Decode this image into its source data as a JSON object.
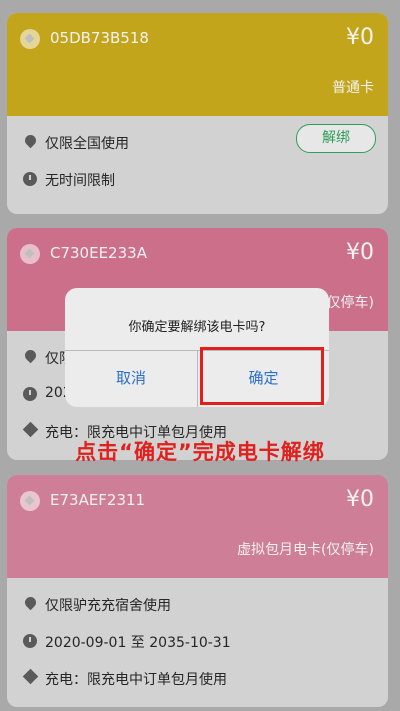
{
  "cards": [
    {
      "id": "05DB73B518",
      "amount": "¥0",
      "type": "普通卡",
      "scope": "仅限全国使用",
      "time": "无时间限制",
      "unbind_label": "解绑",
      "color": "#c3a51b"
    },
    {
      "id": "C730EE233A",
      "amount": "¥0",
      "type": "(仅停车)",
      "scope": "仅限",
      "time": "202",
      "charge": "充电：限充电中订单包月使用",
      "color": "#cc6f8b"
    },
    {
      "id": "E73AEF2311",
      "amount": "¥0",
      "type": "虚拟包月电卡(仅停车)",
      "scope": "仅限驴充充宿舍使用",
      "time": "2020-09-01 至 2035-10-31",
      "charge": "充电：限充电中订单包月使用",
      "color": "#cf7e98"
    }
  ],
  "dialog": {
    "message": "你确定要解绑该电卡吗?",
    "cancel_label": "取消",
    "confirm_label": "确定"
  },
  "annotation": "点击“确定”完成电卡解绑",
  "icons": {
    "badge": "card-badge-icon",
    "location": "location-pin-icon",
    "clock": "clock-icon",
    "charge": "charge-icon"
  },
  "colors": {
    "overlay": "#a9a9a9",
    "accent_green": "#2e9e5b",
    "dialog_button": "#2a6fc9",
    "annotation_red": "#e0201d"
  }
}
